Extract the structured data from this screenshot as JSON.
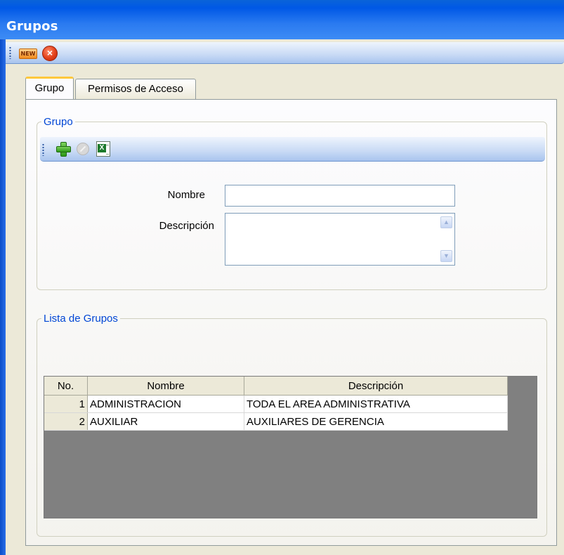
{
  "window": {
    "title": "Grupos"
  },
  "toolbar": {
    "new_label": "NEW"
  },
  "tabs": [
    {
      "label": "Grupo",
      "active": true
    },
    {
      "label": "Permisos de Acceso",
      "active": false
    }
  ],
  "group_section": {
    "legend": "Grupo",
    "fields": {
      "nombre_label": "Nombre",
      "nombre_value": "",
      "descripcion_label": "Descripción",
      "descripcion_value": ""
    }
  },
  "list_section": {
    "legend": "Lista de Grupos",
    "columns": [
      "No.",
      "Nombre",
      "Descripción"
    ],
    "rows": [
      {
        "no": "1",
        "nombre": "ADMINISTRACION",
        "descripcion": "TODA EL AREA ADMINISTRATIVA"
      },
      {
        "no": "2",
        "nombre": "AUXILIAR",
        "descripcion": "AUXILIARES DE GERENCIA"
      }
    ]
  },
  "colors": {
    "titlebar": "#0058e6",
    "legend": "#0046d5",
    "active_tab_accent": "#ffc83c",
    "grid_background": "#808080"
  },
  "icons": [
    "new-icon",
    "close-icon",
    "add-icon",
    "cancel-icon",
    "excel-export-icon"
  ]
}
